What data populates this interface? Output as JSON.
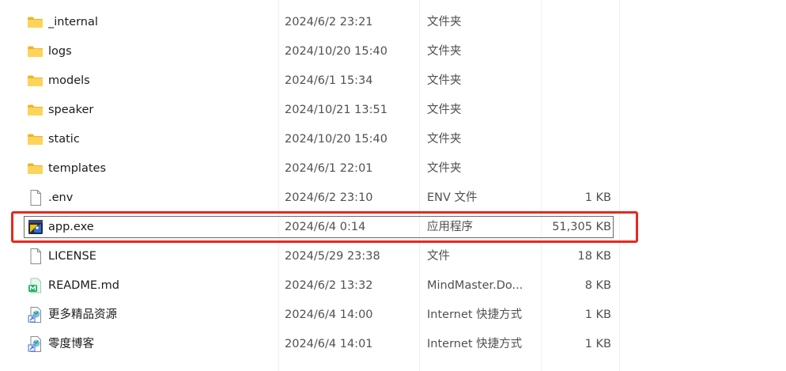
{
  "files": [
    {
      "name": "_internal",
      "date": "2024/6/2 23:21",
      "type": "文件夹",
      "size": "",
      "icon": "folder-icon"
    },
    {
      "name": "logs",
      "date": "2024/10/20 15:40",
      "type": "文件夹",
      "size": "",
      "icon": "folder-icon"
    },
    {
      "name": "models",
      "date": "2024/6/1 15:34",
      "type": "文件夹",
      "size": "",
      "icon": "folder-icon"
    },
    {
      "name": "speaker",
      "date": "2024/10/21 13:51",
      "type": "文件夹",
      "size": "",
      "icon": "folder-icon"
    },
    {
      "name": "static",
      "date": "2024/10/20 15:40",
      "type": "文件夹",
      "size": "",
      "icon": "folder-icon"
    },
    {
      "name": "templates",
      "date": "2024/6/1 22:01",
      "type": "文件夹",
      "size": "",
      "icon": "folder-icon"
    },
    {
      "name": ".env",
      "date": "2024/6/2 23:10",
      "type": "ENV 文件",
      "size": "1 KB",
      "icon": "file-icon"
    },
    {
      "name": "app.exe",
      "date": "2024/6/4 0:14",
      "type": "应用程序",
      "size": "51,305 KB",
      "icon": "exe-icon"
    },
    {
      "name": "LICENSE",
      "date": "2024/5/29 23:38",
      "type": "文件",
      "size": "18 KB",
      "icon": "file-icon"
    },
    {
      "name": "README.md",
      "date": "2024/6/2 13:32",
      "type": "MindMaster.Do...",
      "size": "8 KB",
      "icon": "mindmaster-icon"
    },
    {
      "name": "更多精品资源",
      "date": "2024/6/4 14:00",
      "type": "Internet 快捷方式",
      "size": "1 KB",
      "icon": "internet-shortcut-icon"
    },
    {
      "name": "零度博客",
      "date": "2024/6/4 14:01",
      "type": "Internet 快捷方式",
      "size": "1 KB",
      "icon": "internet-shortcut-icon"
    }
  ],
  "colors": {
    "highlight": "#e8281e",
    "folder": "#f4c430",
    "text": "#1a1a1a",
    "meta_text": "#505050"
  }
}
